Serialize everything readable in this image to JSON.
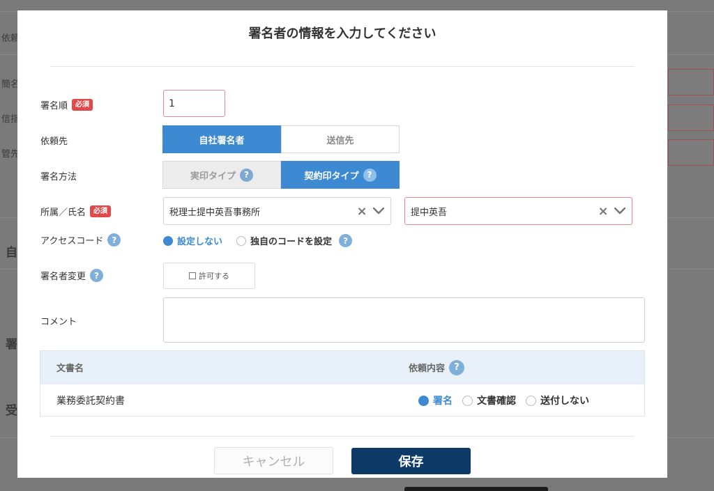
{
  "background": {
    "labels": [
      "依頼",
      "簡名",
      "信指",
      "管先",
      "自",
      "署",
      "受"
    ]
  },
  "dialog": {
    "title": "署名者の情報を入力してください",
    "required_badge": "必須",
    "fields": {
      "signing_order": {
        "label": "署名順",
        "value": "1"
      },
      "request_to": {
        "label": "依頼先",
        "options": [
          "自社署名者",
          "送信先"
        ],
        "selected": "自社署名者"
      },
      "signing_method": {
        "label": "署名方法",
        "options": [
          "実印タイプ",
          "契約印タイプ"
        ],
        "selected": "契約印タイプ"
      },
      "affiliation_name": {
        "label": "所属／氏名",
        "affiliation": "税理士提中英吾事務所",
        "name": "提中英吾"
      },
      "access_code": {
        "label": "アクセスコード",
        "options": [
          "設定しない",
          "独自のコードを設定"
        ],
        "selected": "設定しない"
      },
      "signer_change": {
        "label": "署名者変更",
        "checkbox_label": "許可する"
      },
      "comment": {
        "label": "コメント",
        "value": ""
      }
    },
    "documents": {
      "headers": {
        "name": "文書名",
        "request": "依頼内容"
      },
      "rows": [
        {
          "name": "業務委託契約書",
          "options": [
            "署名",
            "文書確認",
            "送付しない"
          ],
          "selected": "署名"
        }
      ]
    },
    "buttons": {
      "cancel": "キャンセル",
      "save": "保存"
    }
  },
  "colors": {
    "accent": "#3d8ad2",
    "primary_button": "#0d3a66",
    "required": "#e04a4a",
    "help": "#7fb0da"
  }
}
